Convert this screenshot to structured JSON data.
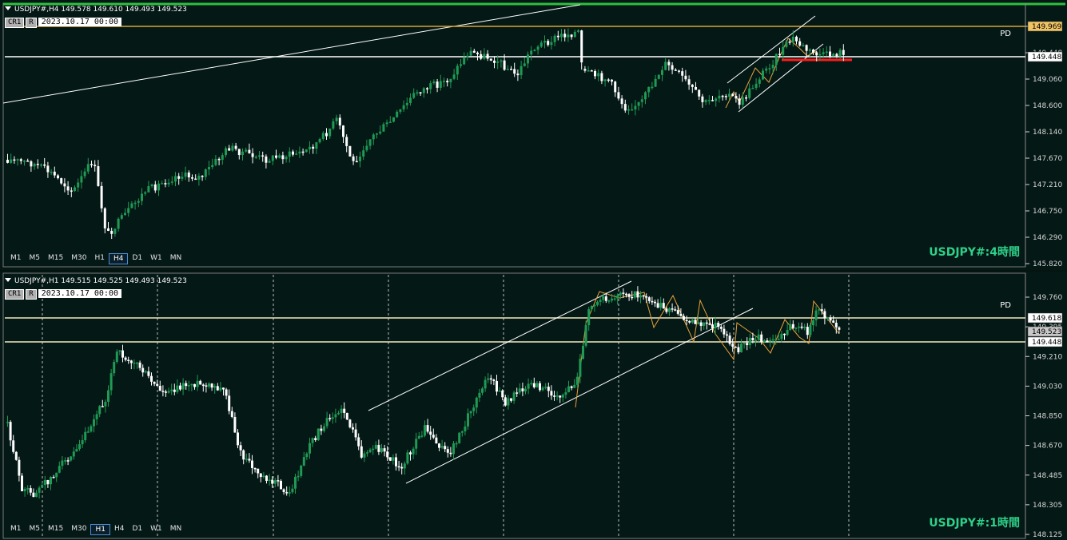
{
  "h4": {
    "header": "USDJPY#,H4  149.578 149.610 149.493 149.523",
    "cr_button": "CR1",
    "r_button": "R",
    "date": "2023.10.17  00:00",
    "pd_label": "PD",
    "symbol_label": "USDJPY#:4時間",
    "timeframes": [
      "M1",
      "M5",
      "M15",
      "M30",
      "H1",
      "H4",
      "D1",
      "W1",
      "MN"
    ],
    "active_timeframe": "H4",
    "price_ticks": [
      "149.969",
      "149.448",
      "149.060",
      "148.600",
      "148.140",
      "147.670",
      "147.210",
      "146.750",
      "146.290",
      "145.820"
    ],
    "tagged_prices": [
      "149.969",
      "149.448"
    ]
  },
  "h1": {
    "header": "USDJPY#,H1  149.515 149.525 149.493 149.523",
    "cr_button": "CR1",
    "r_button": "R",
    "date": "2023.10.17  00:00",
    "pd_label": "PD",
    "symbol_label": "USDJPY#:1時間",
    "timeframes": [
      "M1",
      "M5",
      "M15",
      "M30",
      "H1",
      "H4",
      "D1",
      "W1",
      "MN"
    ],
    "active_timeframe": "H1",
    "price_ticks": [
      "149.760",
      "149.395",
      "149.210",
      "149.030",
      "148.850",
      "148.670",
      "148.485",
      "148.305",
      "148.125"
    ],
    "tagged_prices": [
      "149.618",
      "149.523",
      "149.448"
    ]
  },
  "colors": {
    "background": "#041815",
    "bull": "#1f9a55",
    "bear": "#ffffff",
    "accent": "#2ed18a",
    "orange_line": "#e8a23a",
    "red_zone": "#ff1a1a",
    "gridline": "#bcbcbc"
  }
}
